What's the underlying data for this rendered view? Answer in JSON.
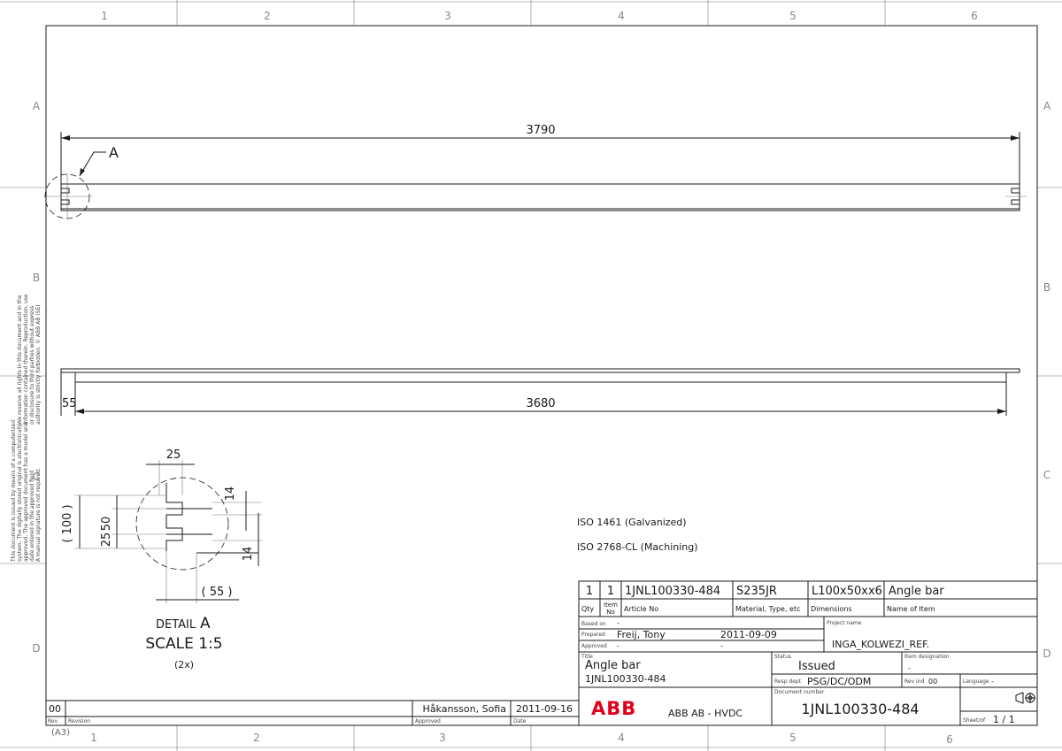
{
  "frame": {
    "columns": [
      "1",
      "2",
      "3",
      "4",
      "5",
      "6"
    ],
    "rows": [
      "A",
      "B",
      "C",
      "D"
    ],
    "sheet_size": "(A3)"
  },
  "side_notes": {
    "rights_lines": [
      "We reserve all rights in this document and in the",
      "information contained therein. Reproduction, use",
      "or disclosure to third parties without express",
      "authority is strictly forbidden.   © ABB AB (SE)"
    ],
    "approval_lines": [
      "This document is issued by means of a computerized",
      "system. The digitally stored original is electronically",
      "approved. The approved document has a model and",
      "date entered in the approved field",
      "A manual signature is not required."
    ]
  },
  "drawing": {
    "top_length": "3790",
    "detail_callout": "A",
    "bottom_length": "3680",
    "bottom_offset": "55",
    "detail": {
      "dim_top": "25",
      "dim_slot": "14",
      "dim_bottom_right": "14",
      "dim_left_total": "( 100 )",
      "dim_left_a": "50",
      "dim_left_b": "25",
      "dim_bottom": "( 55 )",
      "label": "DETAIL",
      "letter": "A",
      "scale": "SCALE 1:5",
      "count": "(2x)"
    },
    "notes": [
      "ISO 1461 (Galvanized)",
      "ISO 2768-CL (Machining)"
    ]
  },
  "parts_list": {
    "qty": "1",
    "item_no": "1",
    "article_no": "1JNL100330-484",
    "material": "S235JR",
    "dimensions": "L100x50xx6",
    "name": "Angle bar",
    "headers": {
      "qty": "Qty",
      "item_a": "Item",
      "item_b": "No",
      "article": "Article No",
      "material": "Material, Type, etc",
      "dimensions": "Dimensions",
      "name": "Name of Item"
    }
  },
  "title_block": {
    "based_on_label": "Based on",
    "based_on": "-",
    "prepared_label": "Prepared",
    "prepared_by": "Freij, Tony",
    "prepared_date": "2011-09-09",
    "approved_label": "Approved",
    "approved_by": "-",
    "approved_date": "-",
    "project_label": "Project name",
    "project": "INGA_KOLWEZI_REF.",
    "title_label": "Title",
    "title_1": "Angle bar",
    "title_2": "1JNL100330-484",
    "status_label": "Status",
    "status": "Issued",
    "item_designation_label": "Item designation",
    "item_designation": "-",
    "resp_dept_label": "Resp dept",
    "resp_dept": "PSG/DC/ODM",
    "rev_ind_label": "Rev ind",
    "rev_ind": "00",
    "language_label": "Language",
    "language": "-",
    "docnum_label": "Document number",
    "document_number": "1JNL100330-484",
    "company_logo": "ABB",
    "company": "ABB AB  -  HVDC",
    "sheet_label": "Sheet/of",
    "sheet": "1 / 1"
  },
  "revision_block": {
    "rev": "00",
    "rev_label": "Rev",
    "revision_label": "Revision",
    "approved_label": "Approved",
    "date_label": "Date",
    "approved_by": "Håkansson, Sofia",
    "date": "2011-09-16"
  },
  "colors": {
    "logo_red": "#e2001a",
    "line": "#1a1a1a"
  }
}
